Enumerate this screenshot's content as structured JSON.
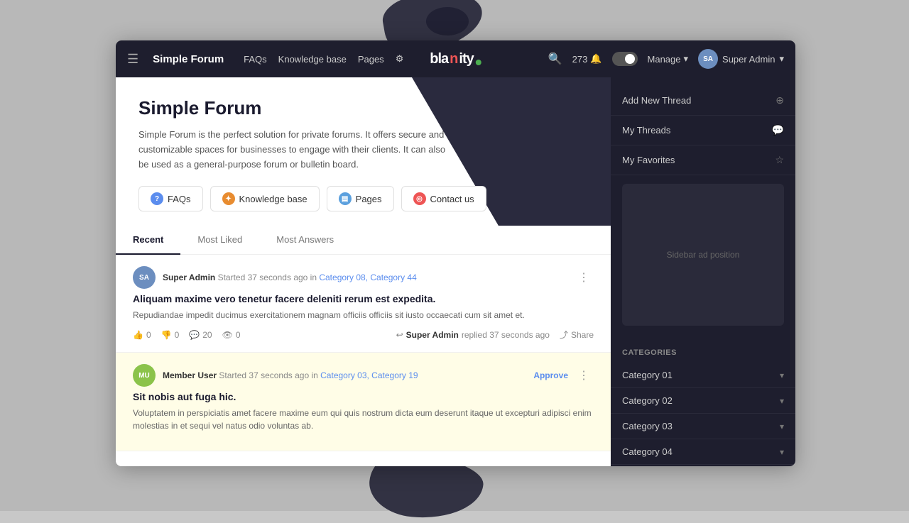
{
  "page": {
    "bg_color": "#c0c0c0"
  },
  "topnav": {
    "hamburger": "☰",
    "brand": "Simple Forum",
    "links": [
      {
        "label": "FAQs",
        "id": "faqs"
      },
      {
        "label": "Knowledge base",
        "id": "kb"
      },
      {
        "label": "Pages",
        "id": "pages"
      },
      {
        "label": "⚙",
        "id": "settings"
      }
    ],
    "logo": {
      "bla": "bla",
      "n": "n",
      "ity": "ity"
    },
    "badge_count": "273",
    "manage_label": "Manage",
    "user_label": "Super Admin",
    "user_initials": "SA"
  },
  "hero": {
    "title": "Simple Forum",
    "description": "Simple Forum is the perfect solution for private forums. It offers secure and customizable spaces for businesses to engage with their clients. It can also be used as a general-purpose forum or bulletin board.",
    "nav_pills": [
      {
        "label": "FAQs",
        "icon": "?",
        "icon_class": "pill-icon-faqs"
      },
      {
        "label": "Knowledge base",
        "icon": "✦",
        "icon_class": "pill-icon-kb"
      },
      {
        "label": "Pages",
        "icon": "▤",
        "icon_class": "pill-icon-pages"
      },
      {
        "label": "Contact us",
        "icon": "◎",
        "icon_class": "pill-icon-contact"
      }
    ]
  },
  "tabs": [
    {
      "label": "Recent",
      "id": "recent",
      "active": true
    },
    {
      "label": "Most Liked",
      "id": "most-liked"
    },
    {
      "label": "Most Answers",
      "id": "most-answers"
    }
  ],
  "threads": [
    {
      "id": 1,
      "avatar_initials": "SA",
      "avatar_class": "avatar-sa",
      "username": "Super Admin",
      "meta": "Started 37 seconds ago in",
      "categories": "Category 08, Category 44",
      "title": "Aliquam maxime vero tenetur facere deleniti rerum est expedita.",
      "excerpt": "Repudiandae impedit ducimus exercitationem magnam officiis officiis sit iusto occaecati cum sit amet et.",
      "likes": "0",
      "dislikes": "0",
      "comments": "20",
      "views": "0",
      "replied_by": "Super Admin",
      "reply_time": "replied 37 seconds ago",
      "share_label": "Share",
      "highlighted": false,
      "show_approve": false
    },
    {
      "id": 2,
      "avatar_initials": "MU",
      "avatar_class": "avatar-mu",
      "username": "Member User",
      "meta": "Started 37 seconds ago in",
      "categories": "Category 03, Category 19",
      "title": "Sit nobis aut fuga hic.",
      "excerpt": "Voluptatem in perspiciatis amet facere maxime eum qui quis nostrum dicta eum deserunt itaque ut excepturi adipisci enim molestias in et sequi vel natus odio voluntas ab.",
      "likes": "",
      "dislikes": "",
      "comments": "",
      "views": "",
      "replied_by": "",
      "reply_time": "",
      "share_label": "",
      "highlighted": true,
      "show_approve": true,
      "approve_label": "Approve"
    }
  ],
  "sidebar": {
    "items": [
      {
        "label": "Add New Thread",
        "icon": "⊕",
        "id": "add-new-thread"
      },
      {
        "label": "My Threads",
        "icon": "💬",
        "id": "my-threads"
      },
      {
        "label": "My Favorites",
        "icon": "☆",
        "id": "my-favorites"
      }
    ],
    "ad_text": "Sidebar ad position",
    "categories_title": "Categories",
    "categories": [
      {
        "label": "Category 01",
        "id": "cat-01"
      },
      {
        "label": "Category 02",
        "id": "cat-02"
      },
      {
        "label": "Category 03",
        "id": "cat-03"
      },
      {
        "label": "Category 04",
        "id": "cat-04"
      }
    ]
  }
}
